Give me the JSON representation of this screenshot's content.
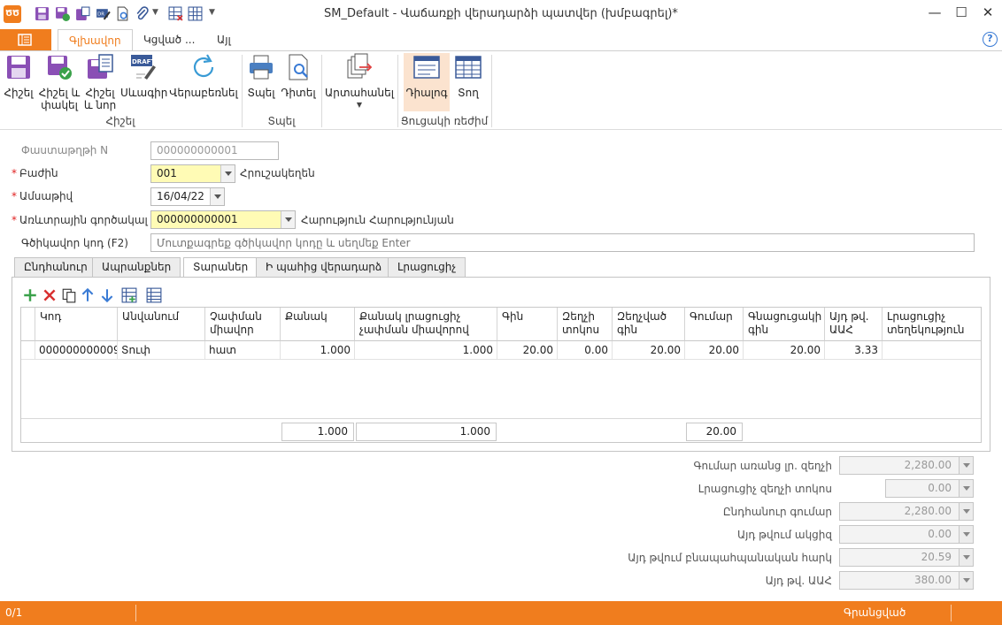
{
  "window": {
    "title": "SM_Default - Վաճառքի վերադարձի պատվեր (խմբագրել)*",
    "logo_text": "ԾԾ",
    "buttons": [
      "—",
      "☐",
      "✕"
    ]
  },
  "ribbon_tabs": {
    "tabs": [
      "Գլխավոր",
      "Կցված ...",
      "Այլ"
    ],
    "help": "?"
  },
  "ribbon": {
    "save_group": {
      "label": "Հիշել",
      "save": "Հիշել",
      "save_close_1": "Հիշել և",
      "save_close_2": "փակել",
      "save_new_1": "Հիշել",
      "save_new_2": "և նոր",
      "draft": "Սևագիր",
      "refresh": "Վերաբեռնել"
    },
    "print_group": {
      "label": "Տպել",
      "print": "Տպել",
      "view": "Դիտել"
    },
    "export": "Արտահանել",
    "view_group": {
      "label": "Ցուցակի ռեժիմ",
      "dialog": "Դիալոգ",
      "row": "Տող"
    },
    "draft_badge": "DRAFT"
  },
  "form": {
    "doc_no_label": "Փաստաթղթի N",
    "doc_no_value": "000000000001",
    "division_label": "Բաժին",
    "division_value": "001",
    "division_name": "Հրուշակեղեն",
    "date_label": "Ամսաթիվ",
    "date_value": "16/04/22",
    "agent_label": "Առևտրային գործակալ",
    "agent_value": "000000000001",
    "agent_name": "Հարություն Հարությունյան",
    "barcode_label": "Գծիկավոր կոդ (F2)",
    "barcode_placeholder": "Մուտքագրեք գծիկավոր կոդը և սեղմեք Enter"
  },
  "tabs": [
    "Ընդհանուր",
    "Ապրանքներ",
    "Տարաներ",
    "Ի պահից վերադարձ",
    "Լրացուցիչ"
  ],
  "grid": {
    "headers": [
      [
        "Կոդ"
      ],
      [
        "Անվանում"
      ],
      [
        "Չափման",
        "միավոր"
      ],
      [
        "Քանակ"
      ],
      [
        "Քանակ լրացուցիչ",
        "չափման միավորով"
      ],
      [
        "Գին"
      ],
      [
        "Զեղչի",
        "տոկոս"
      ],
      [
        "Զեղչված",
        "գին"
      ],
      [
        "Գումար"
      ],
      [
        "Գնացուցակի",
        "գին"
      ],
      [
        "Այդ թվ.",
        "ԱԱՀ"
      ],
      [
        "Լրացուցիչ",
        "տեղեկություն"
      ]
    ],
    "rows": [
      [
        "000000000009",
        "Տուփ",
        "հատ",
        "1.000",
        "1.000",
        "20.00",
        "0.00",
        "20.00",
        "20.00",
        "20.00",
        "3.33",
        ""
      ]
    ],
    "totals": {
      "quantity": "1.000",
      "quantity_extra": "1.000",
      "amount": "20.00"
    }
  },
  "summary": [
    {
      "label": "Գումար առանց լր. զեղչի",
      "value": "2,280.00"
    },
    {
      "label": "Լրացուցիչ զեղչի տոկոս",
      "value": "0.00"
    },
    {
      "label": "Ընդհանուր գումար",
      "value": "2,280.00"
    },
    {
      "label": "Այդ թվում ակցիզ",
      "value": "0.00"
    },
    {
      "label": "Այդ թվում բնապահպանական հարկ",
      "value": "20.59"
    },
    {
      "label": "Այդ թվ. ԱԱՀ",
      "value": "380.00"
    }
  ],
  "status": {
    "position": "0/1",
    "state": "Գրանցված"
  },
  "colors": {
    "accent": "#f07d1e",
    "required": "#e02020",
    "highlight": "#fffbb5",
    "icon_purple": "#7b4fa6",
    "icon_green": "#3aa14a",
    "icon_blue": "#3a7bd5",
    "icon_red": "#d83030"
  }
}
